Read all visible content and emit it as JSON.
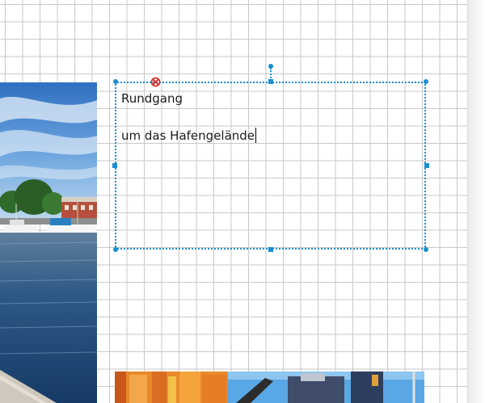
{
  "canvas": {
    "grid_color": "#c9c9c9",
    "background_color": "#ffffff"
  },
  "textbox": {
    "line1": "Rundgang",
    "line2": "um das Hafengelände",
    "selection_color": "#1a8ed1",
    "text_color": "#1b1b1b"
  },
  "icons": {
    "anchor": "anchor-crosshair-icon",
    "rotate": "rotate-handle-icon"
  },
  "anchor_color": "#d32f2f"
}
